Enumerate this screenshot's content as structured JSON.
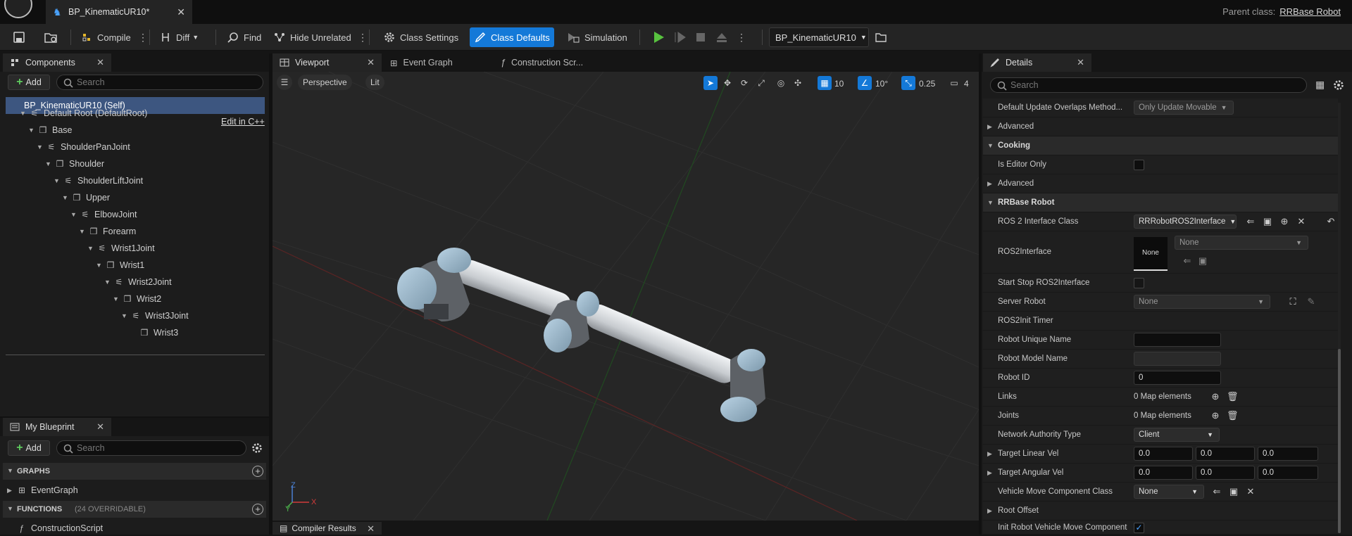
{
  "window": {
    "doc_tab_title": "BP_KinematicUR10*",
    "parent_class_label": "Parent class:",
    "parent_class_value": "RRBase Robot"
  },
  "toolbar": {
    "compile": "Compile",
    "diff": "Diff",
    "find": "Find",
    "hide_unrelated": "Hide Unrelated",
    "class_settings": "Class Settings",
    "class_defaults": "Class Defaults",
    "simulation": "Simulation",
    "debug_object": "BP_KinematicUR10"
  },
  "components": {
    "tab": "Components",
    "add_label": "Add",
    "search_placeholder": "Search",
    "self_item": "BP_KinematicUR10 (Self)",
    "edit_cpp": "Edit in C++",
    "items": [
      {
        "label": "Default Root (DefaultRoot)",
        "icon": "joint-icon"
      },
      {
        "label": "Base",
        "icon": "mesh-icon"
      },
      {
        "label": "ShoulderPanJoint",
        "icon": "joint-icon"
      },
      {
        "label": "Shoulder",
        "icon": "mesh-icon"
      },
      {
        "label": "ShoulderLiftJoint",
        "icon": "joint-icon"
      },
      {
        "label": "Upper",
        "icon": "mesh-icon"
      },
      {
        "label": "ElbowJoint",
        "icon": "joint-icon"
      },
      {
        "label": "Forearm",
        "icon": "mesh-icon"
      },
      {
        "label": "Wrist1Joint",
        "icon": "joint-icon"
      },
      {
        "label": "Wrist1",
        "icon": "mesh-icon"
      },
      {
        "label": "Wrist2Joint",
        "icon": "joint-icon"
      },
      {
        "label": "Wrist2",
        "icon": "mesh-icon"
      },
      {
        "label": "Wrist3Joint",
        "icon": "joint-icon"
      },
      {
        "label": "Wrist3",
        "icon": "mesh-icon"
      }
    ]
  },
  "my_blueprint": {
    "tab": "My Blueprint",
    "add_label": "Add",
    "search_placeholder": "Search",
    "graphs_header": "GRAPHS",
    "event_graph": "EventGraph",
    "functions_header": "FUNCTIONS",
    "functions_count": "(24 OVERRIDABLE)",
    "construction_script": "ConstructionScript"
  },
  "editor_tabs": {
    "viewport": "Viewport",
    "event_graph": "Event Graph",
    "construction": "Construction Scr..."
  },
  "viewport": {
    "perspective": "Perspective",
    "lit": "Lit",
    "grid_snap": "10",
    "rot_snap": "10°",
    "scale_snap": "0.25",
    "camera_speed": "4",
    "axis_x": "X",
    "axis_y": "Y",
    "axis_z": "Z"
  },
  "compiler_results": {
    "tab": "Compiler Results"
  },
  "details": {
    "tab": "Details",
    "search_placeholder": "Search",
    "rows": {
      "default_update_overlaps": {
        "label": "Default Update Overlaps Method...",
        "value": "Only Update Movable"
      },
      "advanced1": "Advanced",
      "cooking": "Cooking",
      "is_editor_only": "Is Editor Only",
      "advanced2": "Advanced",
      "rrbase_robot": "RRBase Robot",
      "ros2_interface_class": {
        "label": "ROS 2 Interface Class",
        "value": "RRRobotROS2Interface"
      },
      "ros2interface": {
        "label": "ROS2Interface",
        "thumb": "None",
        "value": "None"
      },
      "start_stop": "Start Stop ROS2Interface",
      "server_robot": {
        "label": "Server Robot",
        "value": "None"
      },
      "ros2init_timer": "ROS2Init Timer",
      "robot_unique_name": {
        "label": "Robot Unique Name",
        "value": ""
      },
      "robot_model_name": {
        "label": "Robot Model Name",
        "value": ""
      },
      "robot_id": {
        "label": "Robot ID",
        "value": "0"
      },
      "links": {
        "label": "Links",
        "value": "0 Map elements"
      },
      "joints": {
        "label": "Joints",
        "value": "0 Map elements"
      },
      "network_authority": {
        "label": "Network Authority Type",
        "value": "Client"
      },
      "target_linear_vel": {
        "label": "Target Linear Vel",
        "x": "0.0",
        "y": "0.0",
        "z": "0.0"
      },
      "target_angular_vel": {
        "label": "Target Angular Vel",
        "x": "0.0",
        "y": "0.0",
        "z": "0.0"
      },
      "vehicle_move_class": {
        "label": "Vehicle Move Component Class",
        "value": "None"
      },
      "root_offset": "Root Offset",
      "init_robot_vehicle": "Init Robot Vehicle Move Component"
    }
  },
  "colors": {
    "accent": "#1479d8",
    "selection": "#3d5680",
    "play_green": "#58c23f"
  }
}
